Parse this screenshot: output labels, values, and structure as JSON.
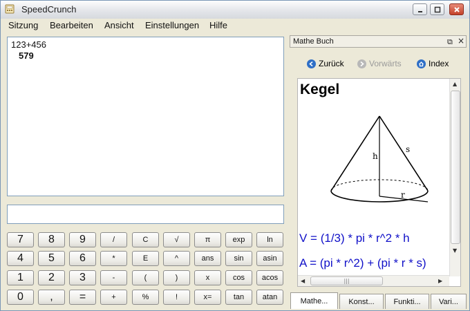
{
  "window": {
    "title": "SpeedCrunch"
  },
  "menu": [
    "Sitzung",
    "Bearbeiten",
    "Ansicht",
    "Einstellungen",
    "Hilfe"
  ],
  "result_pane": {
    "expression": "123+456",
    "result": "579"
  },
  "input": {
    "value": ""
  },
  "keypad": {
    "rows": [
      [
        "7",
        "8",
        "9",
        "/",
        "C",
        "√",
        "π",
        "exp",
        "ln"
      ],
      [
        "4",
        "5",
        "6",
        "*",
        "E",
        "^",
        "ans",
        "sin",
        "asin"
      ],
      [
        "1",
        "2",
        "3",
        "-",
        "(",
        ")",
        "x",
        "cos",
        "acos"
      ],
      [
        "0",
        ",",
        "=",
        "+",
        "%",
        "!",
        "x=",
        "tan",
        "atan"
      ]
    ]
  },
  "book": {
    "header": "Mathe Buch",
    "nav": {
      "back": "Zurück",
      "forward": "Vorwärts",
      "index": "Index"
    },
    "title": "Kegel",
    "cone_labels": {
      "h": "h",
      "s": "s",
      "r": "r"
    },
    "formula_volume": "V = (1/3) * pi * r^2 * h",
    "formula_area": "A = (pi * r^2) + (pi * r * s)",
    "tabs": [
      "Mathe...",
      "Konst...",
      "Funkti...",
      "Vari..."
    ]
  }
}
